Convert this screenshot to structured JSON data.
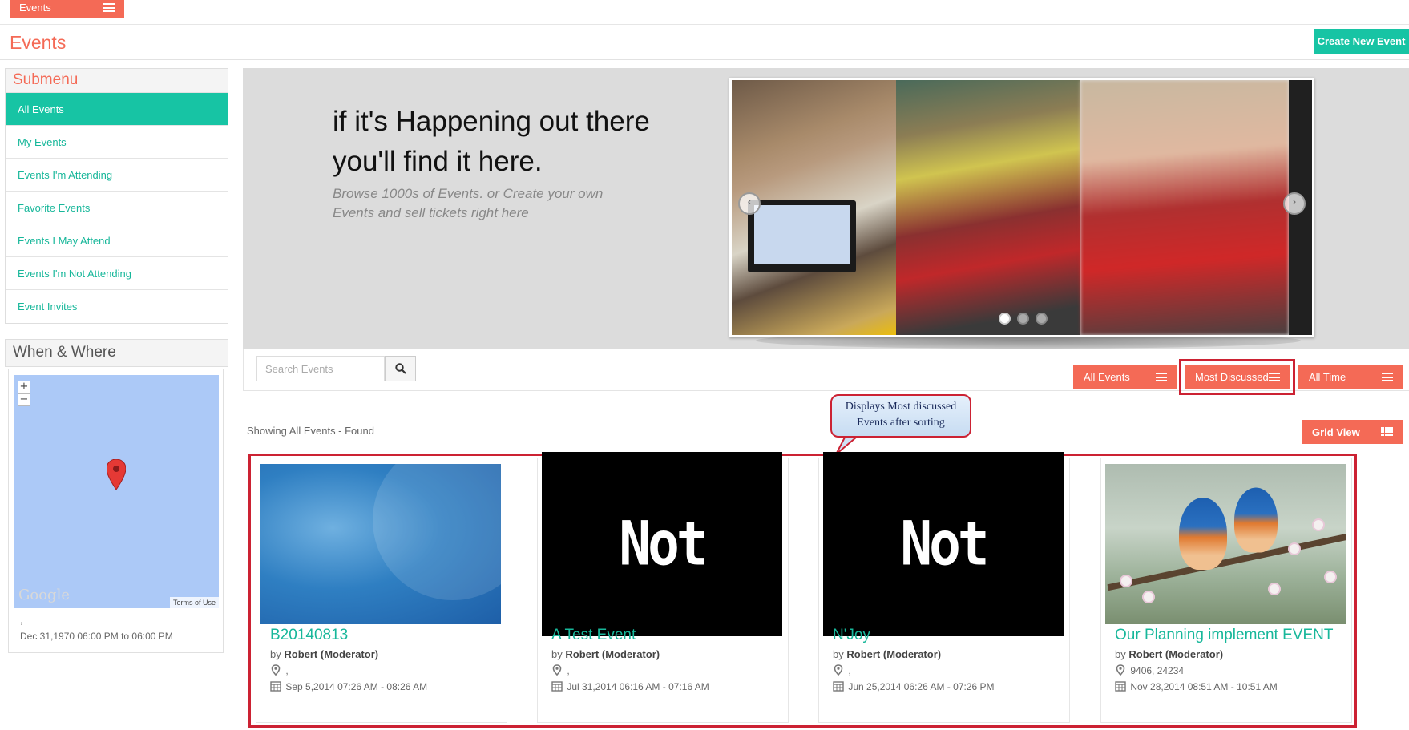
{
  "topbar": {
    "events_label": "Events"
  },
  "header": {
    "title": "Events",
    "create_label": "Create New Event"
  },
  "sidebar": {
    "submenu_title": "Submenu",
    "items": [
      {
        "label": "All Events"
      },
      {
        "label": "My Events"
      },
      {
        "label": "Events I'm Attending"
      },
      {
        "label": "Favorite Events"
      },
      {
        "label": "Events I May Attend"
      },
      {
        "label": "Events I'm Not Attending"
      },
      {
        "label": "Event Invites"
      }
    ],
    "when_where_title": "When & Where",
    "map": {
      "google_label": "Google",
      "terms_label": "Terms of Use",
      "zoom_in": "+",
      "zoom_out": "−"
    },
    "location_text": ",",
    "date_text": "Dec 31,1970 06:00 PM to 06:00 PM"
  },
  "hero": {
    "headline_line1": "if it's Happening out there",
    "headline_line2": "you'll find it here.",
    "sub_line1": "Browse 1000s of Events. or Create your own",
    "sub_line2": "Events and sell tickets right here",
    "slider": {
      "slide_count": 3,
      "active_slide": 1
    }
  },
  "toolbar": {
    "search_placeholder": "Search Events",
    "filters": [
      {
        "label": "All Events"
      },
      {
        "label": "Most Discussed"
      },
      {
        "label": "All Time"
      }
    ],
    "view_label": "Grid View"
  },
  "annotation": {
    "line1": "Displays Most discussed",
    "line2": "Events after sorting"
  },
  "results": {
    "showing_text": "Showing All Events - Found"
  },
  "events": [
    {
      "title": "B20140813",
      "by_prefix": "by",
      "author": "Robert (Moderator)",
      "location": ",",
      "date": "Sep 5,2014 07:26 AM - 08:26 AM",
      "image_text": ""
    },
    {
      "title": "A Test Event",
      "by_prefix": "by",
      "author": "Robert (Moderator)",
      "location": ",",
      "date": "Jul 31,2014 06:16 AM - 07:16 AM",
      "image_text": "Not Found!"
    },
    {
      "title": "N'Joy",
      "by_prefix": "by",
      "author": "Robert (Moderator)",
      "location": ",",
      "date": "Jun 25,2014 06:26 AM - 07:26 PM",
      "image_text": "Not Found!"
    },
    {
      "title": "Our Planning implement EVENT",
      "by_prefix": "by",
      "author": "Robert (Moderator)",
      "location": "9406,  24234",
      "date": "Nov 28,2014 08:51 AM - 10:51 AM",
      "image_text": ""
    }
  ],
  "colors": {
    "accent": "#f46a56",
    "teal": "#17c4a4",
    "highlight": "#cc2233"
  }
}
